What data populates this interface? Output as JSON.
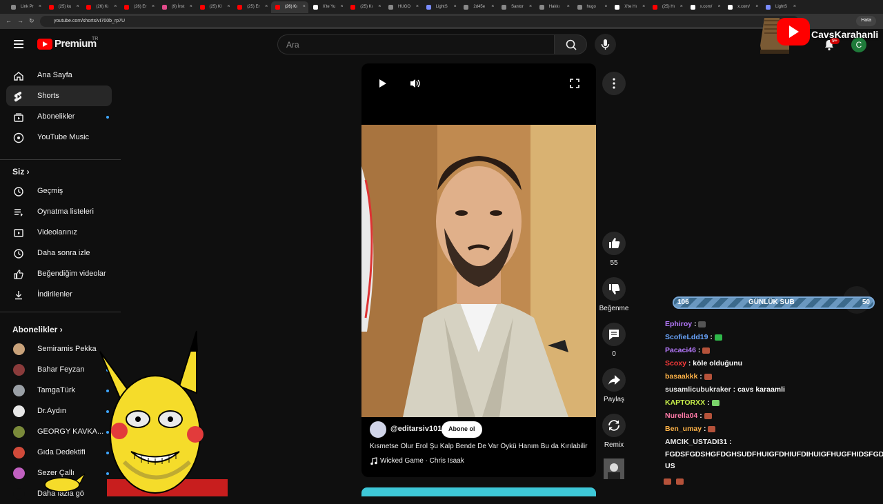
{
  "browser": {
    "tabs": [
      "Link Pr",
      "(25) ku",
      "(26) Kı",
      "(26) Er",
      "(9) İnst",
      "(25) Kl",
      "(25) Er",
      "(26) Kı",
      "X'te Yu",
      "(25) Kı",
      "HUGO",
      "LightS",
      "2d45e",
      "Santor",
      "Hakkı",
      "hugo",
      "X'te Hı",
      "(25) Hı",
      "x.com/",
      "x.com/",
      "LightS"
    ],
    "url": "youtube.com/shorts/vI700b_rp7U",
    "error_label": "Hata"
  },
  "header": {
    "logo_text": "Premium",
    "logo_region": "TR",
    "search_placeholder": "Ara",
    "notif_count": "9+",
    "avatar_letter": "C",
    "channel_name": "CavsKarahanli"
  },
  "sidebar": {
    "main": [
      {
        "label": "Ana Sayfa",
        "icon": "home-icon"
      },
      {
        "label": "Shorts",
        "icon": "shorts-icon"
      },
      {
        "label": "Abonelikler",
        "icon": "subscriptions-icon"
      },
      {
        "label": "YouTube Music",
        "icon": "music-icon"
      }
    ],
    "you_title": "Siz",
    "you": [
      {
        "label": "Geçmiş",
        "icon": "history-icon"
      },
      {
        "label": "Oynatma listeleri",
        "icon": "playlist-icon"
      },
      {
        "label": "Videolarınız",
        "icon": "video-icon"
      },
      {
        "label": "Daha sonra izle",
        "icon": "clock-icon"
      },
      {
        "label": "Beğendiğim videolar",
        "icon": "like-icon"
      },
      {
        "label": "İndirilenler",
        "icon": "download-icon"
      }
    ],
    "subs_title": "Abonelikler",
    "subs": [
      {
        "label": "Semiramis Pekka",
        "color": "#c9a27a"
      },
      {
        "label": "Bahar Feyzan",
        "color": "#8a3b3b"
      },
      {
        "label": "TamgaTürk",
        "color": "#9aa0a6"
      },
      {
        "label": "Dr.Aydın",
        "color": "#e8e8e8"
      },
      {
        "label": "GEORGY KAVKA...",
        "color": "#7a8a3a"
      },
      {
        "label": "Gıda Dedektifi",
        "color": "#d04a3a"
      },
      {
        "label": "Sezer Çallı",
        "color": "#c060c0"
      },
      {
        "label": "Daha fazla gö",
        "color": "#0f0f0f"
      }
    ]
  },
  "short": {
    "channel": "@editarsiv101",
    "subscribe_label": "Abone ol",
    "title": "Kısmetse Olur Erol Şu Kalp Bende De Var Öykü Hanım Bu da Kırılabilir",
    "music": "Wicked Game · Chris Isaak",
    "progress": 0.48
  },
  "actions": {
    "likes": "55",
    "dislike_label": "Beğenme",
    "comments": "0",
    "share_label": "Paylaş",
    "remix_label": "Remix"
  },
  "overlay": {
    "sub_goal": {
      "current": "106",
      "label": "GÜNLÜK SUB",
      "target": "50"
    },
    "chat": [
      {
        "user": "Ephiroy",
        "color": "#b77aff",
        "msg": ""
      },
      {
        "user": "ScofieLdd19",
        "color": "#6aa6ff",
        "msg": ""
      },
      {
        "user": "Pacaci46",
        "color": "#b77aff",
        "msg": ""
      },
      {
        "user": "Scoxy",
        "color": "#ff3b3b",
        "msg": "köle olduğunu"
      },
      {
        "user": "basaakkk",
        "color": "#ffb347",
        "msg": ""
      },
      {
        "user": "susamlicubukraker",
        "color": "#e8e8e8",
        "msg": "cavs karaamli"
      },
      {
        "user": "KAPTORXX",
        "color": "#c8f04a",
        "msg": ""
      },
      {
        "user": "Nurella04",
        "color": "#ff7aa8",
        "msg": ""
      },
      {
        "user": "Ben_umay",
        "color": "#ffb347",
        "msg": ""
      },
      {
        "user": "AMCIK_USTADI31",
        "color": "#e8e8e8",
        "msg": ""
      }
    ],
    "long_message_1": "FGDSFGDSHGFDGHSUDFHUIGFDHIUFDIHUIGFHUGFHIDSFGD",
    "long_message_2": "US"
  }
}
